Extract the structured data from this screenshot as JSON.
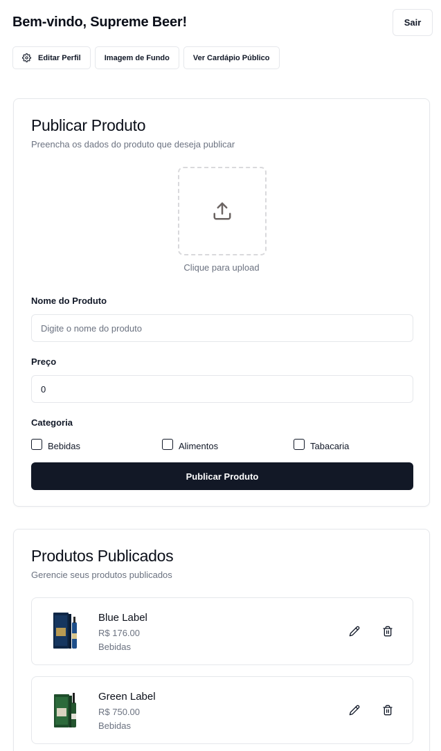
{
  "header": {
    "welcome": "Bem-vindo, Supreme Beer!",
    "logout_label": "Sair"
  },
  "toolbar": {
    "edit_profile_label": "Editar Perfil",
    "edit_profile_icon": "gear-icon",
    "background_image_label": "Imagem de Fundo",
    "public_menu_label": "Ver Cardápio Público"
  },
  "publish": {
    "title": "Publicar Produto",
    "subtitle": "Preencha os dados do produto que deseja publicar",
    "upload_icon": "upload-icon",
    "upload_label": "Clique para upload",
    "name_label": "Nome do Produto",
    "name_placeholder": "Digite o nome do produto",
    "name_value": "",
    "price_label": "Preço",
    "price_value": "0",
    "category_label": "Categoria",
    "categories": [
      {
        "label": "Bebidas",
        "checked": false
      },
      {
        "label": "Alimentos",
        "checked": false
      },
      {
        "label": "Tabacaria",
        "checked": false
      }
    ],
    "submit_label": "Publicar Produto"
  },
  "products_section": {
    "title": "Produtos Publicados",
    "subtitle": "Gerencie seus produtos publicados",
    "items": [
      {
        "name": "Blue Label",
        "price": "R$ 176.00",
        "category": "Bebidas",
        "edit_icon": "pencil-icon",
        "delete_icon": "trash-icon"
      },
      {
        "name": "Green Label",
        "price": "R$ 750.00",
        "category": "Bebidas",
        "edit_icon": "pencil-icon",
        "delete_icon": "trash-icon"
      }
    ]
  },
  "colors": {
    "primary_button": "#121826",
    "border": "#e5e7eb",
    "muted_text": "#6b7280"
  }
}
